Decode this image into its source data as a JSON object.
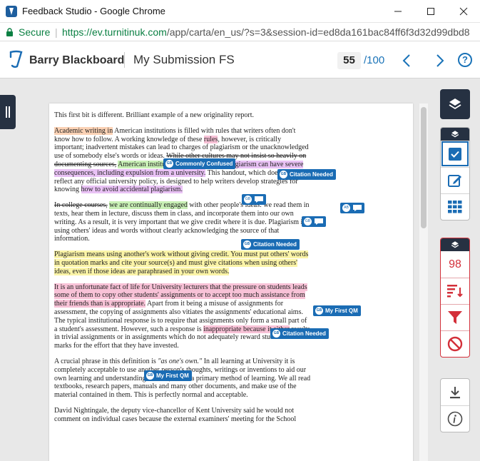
{
  "window": {
    "title": "Feedback Studio - Google Chrome"
  },
  "address": {
    "secure_label": "Secure",
    "url_host": "https://ev.turnitinuk.com",
    "url_path": "/app/carta/en_us/?s=3&session-id=ed8da161bac84ff6f3d32d99dbd8"
  },
  "header": {
    "user_name": "Barry Blackboard",
    "submission_title": "My Submission FS",
    "score": "55",
    "score_total": "/100",
    "help_label": "?"
  },
  "document": {
    "p1": "This first bit is different.  Brilliant example of a new originality report.",
    "p2_a": "Academic writing in",
    "p2_b": " American institutions is filled with rules that writers often don't know how to follow.",
    "p2_c": " A working knowledge of these ",
    "p2_d": "rules",
    "p2_e": ", however, is critically important; inadvertent mistakes can lead to charges of plagiarism or the unacknowledged use of somebody else's words or ideas. ",
    "p2_f": "While other cultures may not insist so heavily on documenting sources,",
    "p2_g": " ",
    "p2_h": "American institutions do.",
    "p2_i": " A charge of plagiarism can have severe consequences, including expulsion from a university.",
    "p2_j": " This handout, which does not reflect any official university policy, is designed to help writers develop strategies for knowing ",
    "p2_k": "how to avoid accidental plagiarism.",
    "p3_a": "In college courses,",
    "p3_b": " ",
    "p3_c": "we are continually engaged",
    "p3_d": " with other people's ideas: we read them in texts, hear them in lecture, discuss them in class, and incorporate them into our own writing. As a result, it is very important that we give credit where it is due. Plagiarism is using others' ideas and words without clearly acknowledging the source of that information.",
    "p4": "Plagiarism means using another's work without giving credit. You must put others' words in quotation marks and cite your source(s) and must give citations when using others' ideas, even if those ideas are paraphrased in your own words.",
    "p5_a": "It is an unfortunate fact of life for University lecturers that the pressure on students leads some of them to copy other students' assignments or to accept too much assistance from their friends than is appropriate.",
    "p5_b": " Apart from it being a misuse of assignments for assessment, the copying of assignments also vitiates the assignments' educational aims. The typical institutional response is to require that assignments only form a small part of a student's assessment. However, such a response is ",
    "p5_c": "inappropriate because it either",
    "p5_d": " results in trivial assignments or in assignments which do not adequately reward students in marks for the effort that they have invested.",
    "p6_a": "A crucial phrase in this definition is ",
    "p6_b": "\"as one's own.\"",
    "p6_c": " In all learning at University it is completely acceptable to use another person's thoughts, writings or inventions to aid our own learning and understanding. Indeed, this is a primary method of learning. We all read textbooks, research papers, manuals and many other documents, and make use of the material contained in them. This is perfectly normal and acceptable.",
    "p7": "David Nightingale, the deputy vice-chancellor of Kent University said he would not comment on individual cases because the external examiners' meeting for the School"
  },
  "marks": {
    "qm_icon": "GB",
    "ab_icon": "AB",
    "commonly_confused": "Commonly Confused",
    "citation_needed": "Citation Needed",
    "my_first_qm": "My First QM"
  },
  "toolbar": {
    "similarity_score": "98"
  },
  "colors": {
    "navy": "#263142",
    "accent_blue": "#1a6cb4",
    "similarity_red": "#d3303a",
    "secure_green": "#0b8043"
  }
}
